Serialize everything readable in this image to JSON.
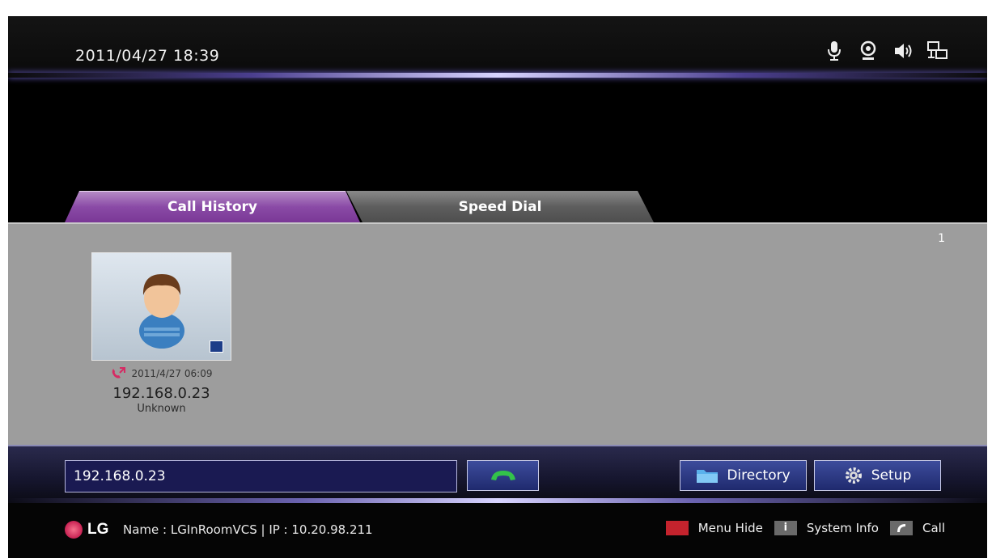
{
  "topbar": {
    "datetime": "2011/04/27  18:39",
    "icons": [
      "microphone-icon",
      "webcam-icon",
      "speaker-icon",
      "network-icon"
    ]
  },
  "tabs": [
    {
      "label": "Call History",
      "active": true
    },
    {
      "label": "Speed Dial",
      "active": false
    }
  ],
  "panel": {
    "page_number": "1",
    "entries": [
      {
        "time": "2011/4/27  06:09",
        "address": "192.168.0.23",
        "name": "Unknown",
        "icon": "outgoing-call-icon"
      }
    ]
  },
  "dialbar": {
    "input_value": "192.168.0.23",
    "call_button_icon": "phone-icon",
    "directory_label": "Directory",
    "setup_label": "Setup"
  },
  "footer": {
    "brand": "LG",
    "info": "Name : LGInRoomVCS  |  IP : 10.20.98.211",
    "legend": [
      {
        "key": "red",
        "label": "Menu Hide"
      },
      {
        "key": "i",
        "label": "System Info"
      },
      {
        "key": "call",
        "label": "Call"
      }
    ]
  },
  "colors": {
    "active_tab": "#8a4aa6",
    "panel": "#9d9d9d",
    "button": "#2a3580",
    "menu_hide_key": "#c4232d"
  }
}
